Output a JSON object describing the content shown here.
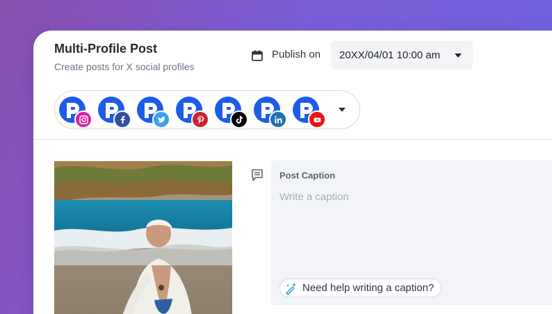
{
  "header": {
    "title": "Multi-Profile Post",
    "subtitle": "Create posts for X social profiles",
    "publish_label": "Publish on",
    "publish_date": "20XX/04/01 10:00 am"
  },
  "profiles": [
    {
      "network": "instagram",
      "badge_color": "#d6249f",
      "icon": "instagram-icon"
    },
    {
      "network": "facebook",
      "badge_color": "#2f4fa3",
      "icon": "facebook-icon"
    },
    {
      "network": "twitter",
      "badge_color": "#3aa3ea",
      "icon": "twitter-icon"
    },
    {
      "network": "pinterest",
      "badge_color": "#c8232c",
      "icon": "pinterest-icon"
    },
    {
      "network": "tiktok",
      "badge_color": "#000000",
      "icon": "tiktok-icon"
    },
    {
      "network": "linkedin",
      "badge_color": "#1f6fb2",
      "icon": "linkedin-icon"
    },
    {
      "network": "youtube",
      "badge_color": "#ee1111",
      "icon": "youtube-icon"
    }
  ],
  "caption": {
    "label": "Post Caption",
    "placeholder": "Write a caption",
    "help_label": "Need help writing a caption?"
  },
  "colors": {
    "avatar_blue": "#1d5ce8",
    "background_gradient": [
      "#8a4fb0",
      "#6d64e0"
    ]
  }
}
